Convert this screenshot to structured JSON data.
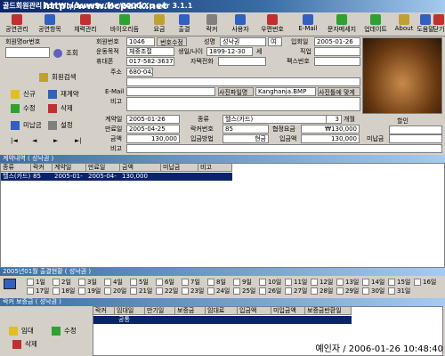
{
  "window": {
    "title": "골드회원관리 for Windows9x/Me/2000/Xp ver 3.1.1",
    "watermark": "http://www.bcpark.net"
  },
  "toolbar": [
    {
      "label": "공연관리",
      "icon": "theater-icon",
      "color": "#c03030"
    },
    {
      "label": "공연항목",
      "icon": "list-icon",
      "color": "#3060c0"
    },
    {
      "label": "체력관리",
      "icon": "fitness-icon",
      "color": "#c03030"
    },
    {
      "label": "바이오리듬",
      "icon": "biorhythm-icon",
      "color": "#30a030"
    },
    {
      "label": "요금",
      "icon": "fee-icon",
      "color": "#c0a030"
    },
    {
      "label": "출결",
      "icon": "attendance-icon",
      "color": "#3060c0"
    },
    {
      "label": "락커",
      "icon": "locker-icon",
      "color": "#808080"
    },
    {
      "label": "사용자",
      "icon": "user-icon",
      "color": "#3060c0"
    },
    {
      "label": "우편번호",
      "icon": "postal-icon",
      "color": "#c03030"
    },
    {
      "label": "E-Mail",
      "icon": "email-icon",
      "color": "#3060c0"
    },
    {
      "label": "문자메세지",
      "icon": "sms-icon",
      "color": "#30a030"
    },
    {
      "label": "업데이트",
      "icon": "update-icon",
      "color": "#30a030"
    },
    {
      "label": "About",
      "icon": "about-icon",
      "color": "#c0a030"
    },
    {
      "label": "도움말",
      "icon": "help-icon",
      "color": "#3060c0"
    },
    {
      "label": "닫기",
      "icon": "close-icon",
      "color": "#c03030"
    }
  ],
  "search": {
    "label": "회원명or번호",
    "value": "",
    "button": "조회"
  },
  "side_buttons": {
    "member_search": "회원검색",
    "new": "신규",
    "re_contract": "재계약",
    "edit": "수정",
    "delete": "삭제",
    "unpaid": "미납금",
    "settings": "설정"
  },
  "member": {
    "id_label": "회원번호",
    "id": "1046",
    "number_edit": "번호수정",
    "name_label": "성명",
    "name": "성낙권",
    "gender": "여",
    "join_label": "입회일",
    "join_date": "2005-01-26",
    "purpose_label": "운동목적",
    "purpose": "체중조절",
    "birth_label": "생일/나이",
    "birth": "1899-12-30",
    "age": "세",
    "job_label": "직업",
    "job": "",
    "mobile_label": "휴대폰",
    "mobile": "017-582-3637",
    "home_phone_label": "자택전화",
    "home_phone": "",
    "fax_label": "팩스번호",
    "fax": "",
    "address_label": "주소",
    "address": "680-042",
    "email_label": "E-Mail",
    "email": "",
    "photo_file_label": "사진파일명",
    "photo_file": "Kanghanja.BMP",
    "fit_photo": "사진틀에 맞게",
    "note_label": "비고",
    "note": ""
  },
  "contract": {
    "contract_date_label": "계약일",
    "contract_date": "2005-01-26",
    "type_label": "종류",
    "type": "헬스(카드)",
    "months": "3",
    "months_unit": "개월",
    "discount_label": "할인",
    "expiry_label": "만료일",
    "expiry": "2005-04-25",
    "locker_label": "락커번호",
    "locker": "85",
    "standard_fee_label": "협정요금",
    "standard_fee": "₩130,000",
    "amount_label": "금액",
    "amount": "130,000",
    "pay_method_label": "입금방법",
    "pay_method": "현금",
    "paid_label": "입금액",
    "paid": "130,000",
    "unpaid_label": "미납금",
    "unpaid": "",
    "note_label": "비고",
    "note": ""
  },
  "contract_history": {
    "title": "계약내역 ( 성낙권 )",
    "columns": [
      "종류",
      "락커",
      "계약일",
      "만료일",
      "금액",
      "미납금",
      "비고"
    ],
    "rows": [
      [
        "헬스(카드)",
        "85",
        "2005-01-26",
        "2005-04-25",
        "130,000",
        "",
        ""
      ]
    ]
  },
  "attendance": {
    "title": "2005년01월 출결현황 ( 성낙권 )",
    "days": [
      "1일",
      "2일",
      "3일",
      "4일",
      "5일",
      "6일",
      "7일",
      "8일",
      "9일",
      "10일",
      "11일",
      "12일",
      "13일",
      "14일",
      "15일",
      "16일",
      "17일",
      "18일",
      "19일",
      "20일",
      "21일",
      "22일",
      "23일",
      "24일",
      "25일",
      "26일",
      "27일",
      "28일",
      "29일",
      "30일",
      "31일"
    ]
  },
  "locker": {
    "title": "락커 보증금 ( 성낙권 )",
    "columns": [
      "락커",
      "임대일",
      "만기일",
      "보증금",
      "임대료",
      "입금액",
      "미입금액",
      "보증금반환일"
    ],
    "rows": [
      [
        "",
        "",
        "",
        "",
        "",
        "",
        "",
        ""
      ]
    ],
    "buttons": {
      "rent": "임대",
      "edit": "수정",
      "delete": "삭제"
    },
    "selected_row_label": "공통"
  },
  "status": "예인자 / 2006-01-26 10:48:40"
}
